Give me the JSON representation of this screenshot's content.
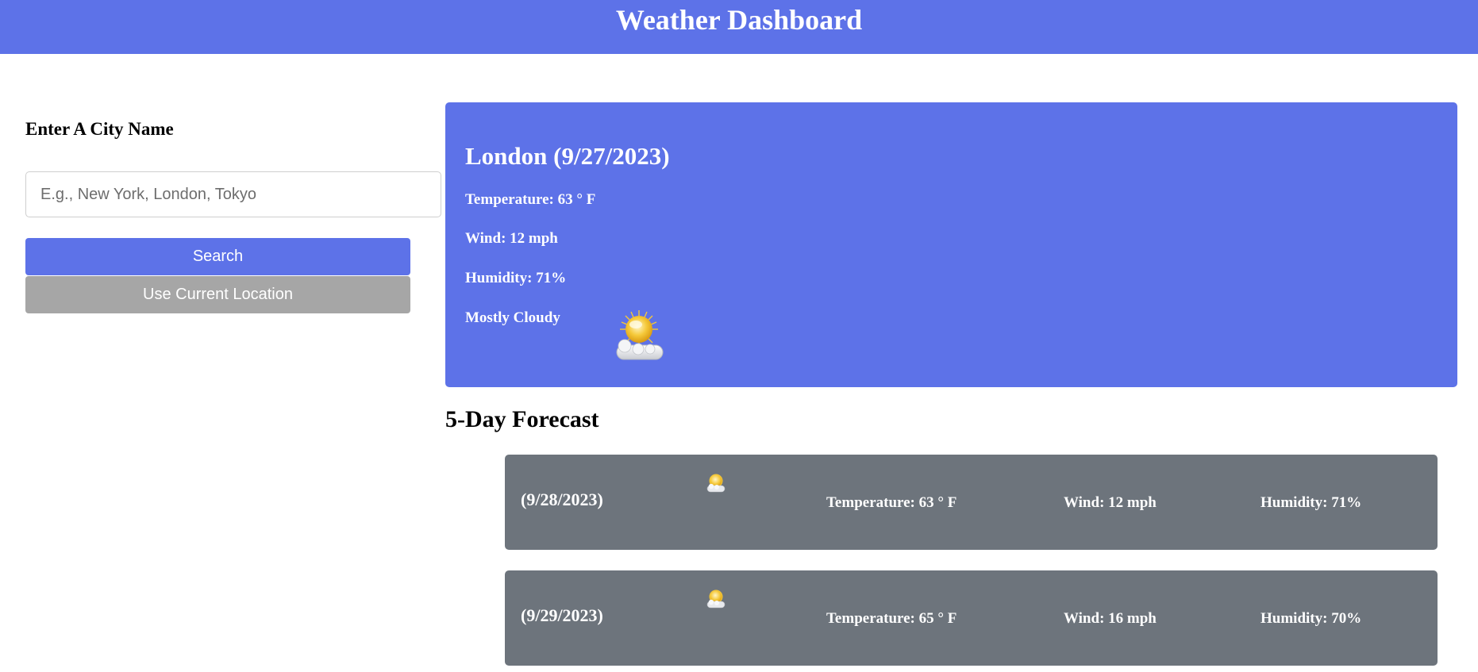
{
  "header": {
    "title": "Weather Dashboard"
  },
  "sidebar": {
    "label": "Enter A City Name",
    "search_placeholder": "E.g., New York, London, Tokyo",
    "search_value": "",
    "search_button": "Search",
    "location_button": "Use Current Location"
  },
  "current": {
    "title": "London (9/27/2023)",
    "temperature": "Temperature: 63 ° F",
    "wind": "Wind: 12 mph",
    "humidity": "Humidity: 71%",
    "description": "Mostly Cloudy",
    "icon": "partly-cloudy-icon"
  },
  "forecast": {
    "heading": "5-Day Forecast",
    "days": [
      {
        "date": "(9/28/2023)",
        "icon": "partly-cloudy-icon",
        "temperature": "Temperature: 63 ° F",
        "wind": "Wind: 12 mph",
        "humidity": "Humidity: 71%"
      },
      {
        "date": "(9/29/2023)",
        "icon": "partly-cloudy-icon",
        "temperature": "Temperature: 65 ° F",
        "wind": "Wind: 16 mph",
        "humidity": "Humidity: 70%"
      }
    ]
  },
  "colors": {
    "accent": "#5d72e8",
    "secondary_button": "#a6a6a6",
    "forecast_card": "#6d747c"
  }
}
